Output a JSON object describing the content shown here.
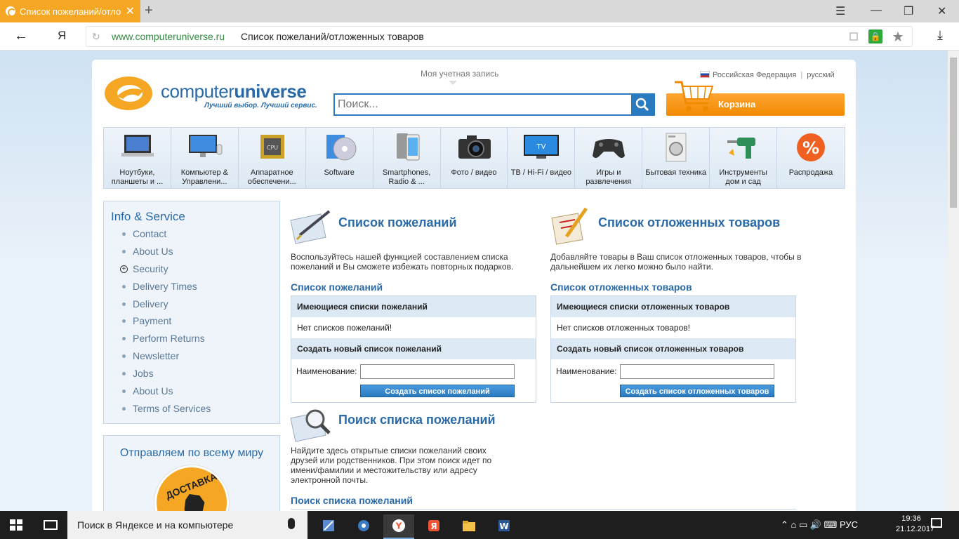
{
  "browser": {
    "tab_title": "Список пожеланий/отло",
    "tab_close": "✕",
    "new_tab": "+",
    "window_controls": [
      "☰",
      "—",
      "❐",
      "✕"
    ],
    "back": "←",
    "yandex_button": "Я",
    "url_host": "www.computeruniverse.ru",
    "url_title": "Список пожеланий/отложенных товаров",
    "icons": [
      "reload-icon",
      "protect-icon",
      "lock-icon",
      "star-icon",
      "download-icon"
    ]
  },
  "header": {
    "logo_name_regular": "computer",
    "logo_name_bold": "universe",
    "logo_tagline": "Лучший выбор. Лучший сервис.",
    "account": "Моя учетная запись",
    "search_placeholder": "Поиск...",
    "region": "Российская Федерация",
    "region_sep": "|",
    "language": "русский",
    "cart": "Корзина"
  },
  "categories": [
    {
      "label": "Ноутбуки, планшеты и ...",
      "icon": "laptop-icon"
    },
    {
      "label": "Компьютер & Управлени...",
      "icon": "desktop-icon"
    },
    {
      "label": "Аппаратное обеспечени...",
      "icon": "cpu-icon"
    },
    {
      "label": "Software",
      "icon": "software-icon"
    },
    {
      "label": "Smartphones, Radio & ...",
      "icon": "smartphone-icon"
    },
    {
      "label": "Фото / видео",
      "icon": "camera-icon"
    },
    {
      "label": "ТВ / Hi-Fi / видео",
      "icon": "tv-icon"
    },
    {
      "label": "Игры и развлечения",
      "icon": "gamepad-icon"
    },
    {
      "label": "Бытовая техника",
      "icon": "washer-icon"
    },
    {
      "label": "Инструменты дом и сад",
      "icon": "drill-icon"
    },
    {
      "label": "Распродажа",
      "icon": "percent-icon"
    }
  ],
  "sidebar": {
    "title": "Info & Service",
    "items": [
      {
        "label": "Contact"
      },
      {
        "label": "About Us"
      },
      {
        "label": "Security"
      },
      {
        "label": "Delivery Times"
      },
      {
        "label": "Delivery"
      },
      {
        "label": "Payment"
      },
      {
        "label": "Perform Returns"
      },
      {
        "label": "Newsletter"
      },
      {
        "label": "Jobs"
      },
      {
        "label": "About Us"
      },
      {
        "label": "Terms of Services"
      }
    ],
    "shipping_title": "Отправляем по всему миру",
    "badge_text": "ДОСТАВКА ИЗ"
  },
  "wishlist": {
    "title": "Список пожеланий",
    "desc": "Воспользуйтесь нашей функцией составлением списка пожеланий и Вы сможете избежать повторных подарков.",
    "subtitle": "Список пожеланий",
    "existing_header": "Имеющиеся списки пожеланий",
    "empty": "Нет списков пожеланий!",
    "create_header": "Создать новый список пожеланий",
    "name_label": "Наименование:",
    "create_button": "Создать список пожеланий"
  },
  "saved": {
    "title": "Список отложенных товаров",
    "desc": "Добавляйте товары в Ваш список отложенных товаров, чтобы в дальнейшем их легко можно было найти.",
    "subtitle": "Список отложенных товаров",
    "existing_header": "Имеющиеся списки отложенных товаров",
    "empty": "Нет списков отложенных товаров!",
    "create_header": "Создать новый список отложенных товаров",
    "name_label": "Наименование:",
    "create_button": "Создать список отложенных товаров"
  },
  "wishlist_search": {
    "title": "Поиск списка пожеланий",
    "desc": "Найдите здесь открытые списки пожеланий своих друзей или родственников. При этом поиск идет по имени/фамилии и местожительству или адресу электронной почты.",
    "subtitle": "Поиск списка пожеланий"
  },
  "taskbar": {
    "search_text": "Поиск в Яндексе и на компьютере",
    "tray": "⌃  ⌂  ▭  🔊  ⌨  РУС",
    "time": "19:36",
    "date": "21.12.2017"
  },
  "colors": {
    "brand_orange": "#f5a623",
    "brand_blue": "#2a6aa8",
    "search_blue": "#2a7ac0"
  }
}
